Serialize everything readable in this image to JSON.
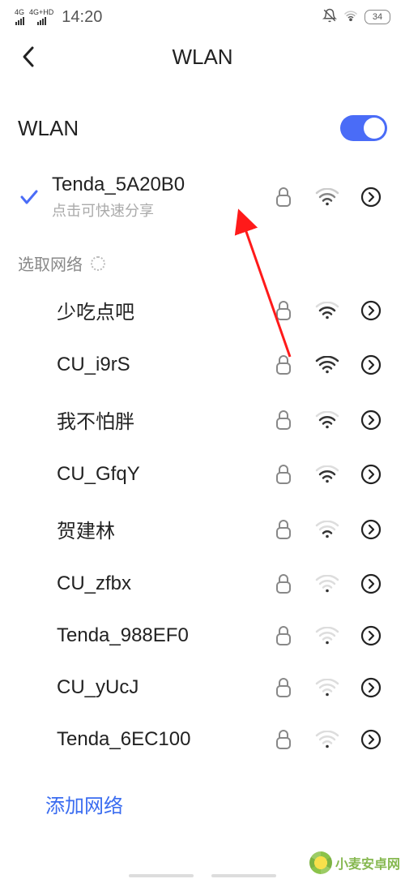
{
  "status": {
    "sig1": "4G",
    "sig2": "4G+HD",
    "time": "14:20",
    "battery": "34"
  },
  "header": {
    "title": "WLAN"
  },
  "toggle": {
    "label": "WLAN"
  },
  "connected": {
    "name": "Tenda_5A20B0",
    "sub": "点击可快速分享"
  },
  "section": {
    "choose": "选取网络"
  },
  "networks": [
    {
      "name": "少吃点吧",
      "strength": 3
    },
    {
      "name": "CU_i9rS",
      "strength": 4
    },
    {
      "name": "我不怕胖",
      "strength": 3
    },
    {
      "name": "CU_GfqY",
      "strength": 3
    },
    {
      "name": "贺建林",
      "strength": 2
    },
    {
      "name": "CU_zfbx",
      "strength": 1
    },
    {
      "name": "Tenda_988EF0",
      "strength": 1
    },
    {
      "name": "CU_yUcJ",
      "strength": 1
    },
    {
      "name": "Tenda_6EC100",
      "strength": 1
    }
  ],
  "add_network": "添加网络",
  "watermark": "小麦安卓网"
}
